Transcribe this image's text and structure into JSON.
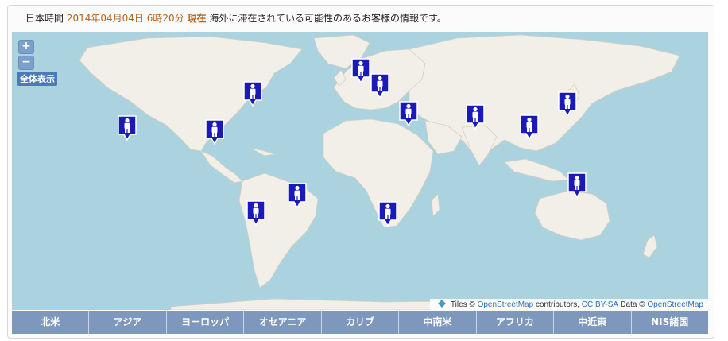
{
  "header": {
    "prefix": "日本時間",
    "datetime": "2014年04月04日 6時20分",
    "now_label": "現在",
    "description": "海外に滞在されている可能性のあるお客様の情報です。"
  },
  "map_controls": {
    "zoom_in": "+",
    "zoom_out": "−",
    "full_view": "全体表示"
  },
  "markers": [
    {
      "region": "North America (east)",
      "icon": "person-icon"
    },
    {
      "region": "Pacific (Hawaii)",
      "icon": "person-icon"
    },
    {
      "region": "Central America",
      "icon": "person-icon"
    },
    {
      "region": "Northern Europe",
      "icon": "person-icon"
    },
    {
      "region": "Central Europe",
      "icon": "person-icon"
    },
    {
      "region": "Middle East",
      "icon": "person-icon"
    },
    {
      "region": "South Asia",
      "icon": "person-icon"
    },
    {
      "region": "East Asia (Japan)",
      "icon": "person-icon"
    },
    {
      "region": "Southeast Asia",
      "icon": "person-icon"
    },
    {
      "region": "Oceania",
      "icon": "person-icon"
    },
    {
      "region": "South America (Brazil)",
      "icon": "person-icon"
    },
    {
      "region": "South America (Chile)",
      "icon": "person-icon"
    },
    {
      "region": "Southern Africa",
      "icon": "person-icon"
    }
  ],
  "attribution": {
    "tiles": "Tiles ©",
    "osm1": "OpenStreetMap",
    "contributors": "contributors,",
    "license": "CC BY-SA",
    "data": "Data ©",
    "osm2": "OpenStreetMap"
  },
  "tabs": [
    "北米",
    "アジア",
    "ヨーロッパ",
    "オセアニア",
    "カリブ",
    "中南米",
    "アフリカ",
    "中近東",
    "NIS諸国"
  ],
  "colors": {
    "ocean": "#aad3df",
    "land": "#f2efe9",
    "marker": "#1a1ab8",
    "tab_bar": "#7e97bd",
    "accent": "#b5651d"
  }
}
